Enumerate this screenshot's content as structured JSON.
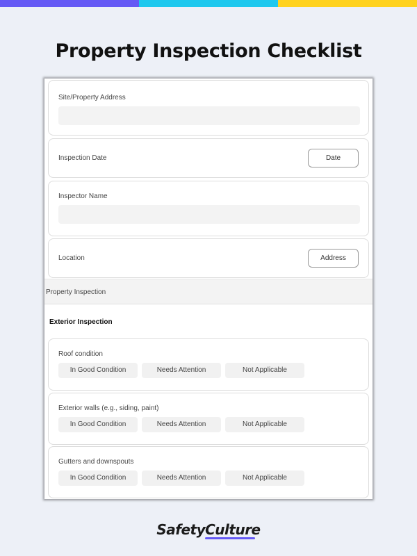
{
  "header": {
    "title": "Property Inspection Checklist",
    "stripe_colors": [
      "#6559f5",
      "#1ec8ee",
      "#ffd21f"
    ]
  },
  "form": {
    "fields": {
      "address": {
        "label": "Site/Property Address",
        "value": ""
      },
      "date": {
        "label": "Inspection Date",
        "button": "Date"
      },
      "inspector": {
        "label": "Inspector Name",
        "value": ""
      },
      "location": {
        "label": "Location",
        "button": "Address"
      }
    },
    "section": "Property Inspection",
    "subsection": "Exterior Inspection",
    "options": [
      "In Good Condition",
      "Needs Attention",
      "Not Applicable"
    ],
    "questions": [
      {
        "label": "Roof condition"
      },
      {
        "label": "Exterior walls (e.g., siding, paint)"
      },
      {
        "label": "Gutters and downspouts"
      }
    ]
  },
  "footer": {
    "brand": "SafetyCulture",
    "brand_accent": "#6559f5"
  }
}
